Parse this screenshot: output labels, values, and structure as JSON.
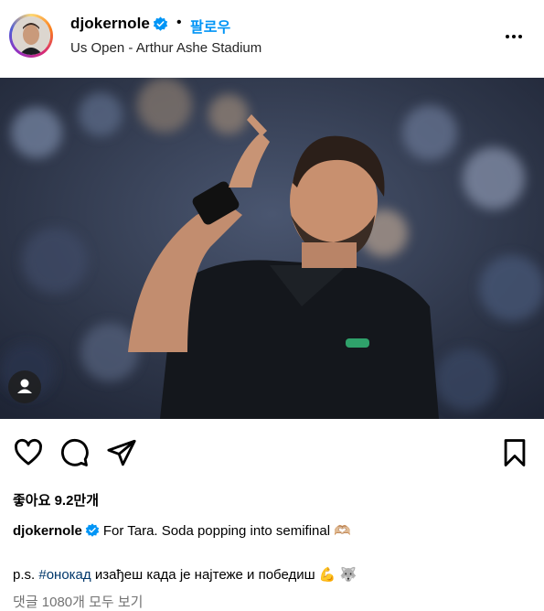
{
  "post": {
    "username": "djokernole",
    "separator": "•",
    "follow_label": "팔로우",
    "location": "Us Open - Arthur Ashe Stadium",
    "likes_text": "좋아요 9.2만개",
    "caption_username": "djokernole",
    "caption_text": "For Tara. Soda popping into semifinal 🫶🏼",
    "ps_prefix": "p.s. ",
    "ps_hashtag": "#онокад",
    "ps_text": " изађеш када је најтеже и победиш 💪 🐺",
    "comments_link": "댓글 1080개 모두 보기"
  },
  "icons": {
    "verified": "verified-badge-icon",
    "more": "more-options-icon",
    "like": "heart-icon",
    "comment": "comment-icon",
    "share": "share-icon",
    "save": "bookmark-icon",
    "user_tag": "user-tag-icon"
  },
  "colors": {
    "accent": "#0095f6",
    "verified": "#0095f6",
    "hashtag": "#00376b",
    "muted": "#737373"
  }
}
